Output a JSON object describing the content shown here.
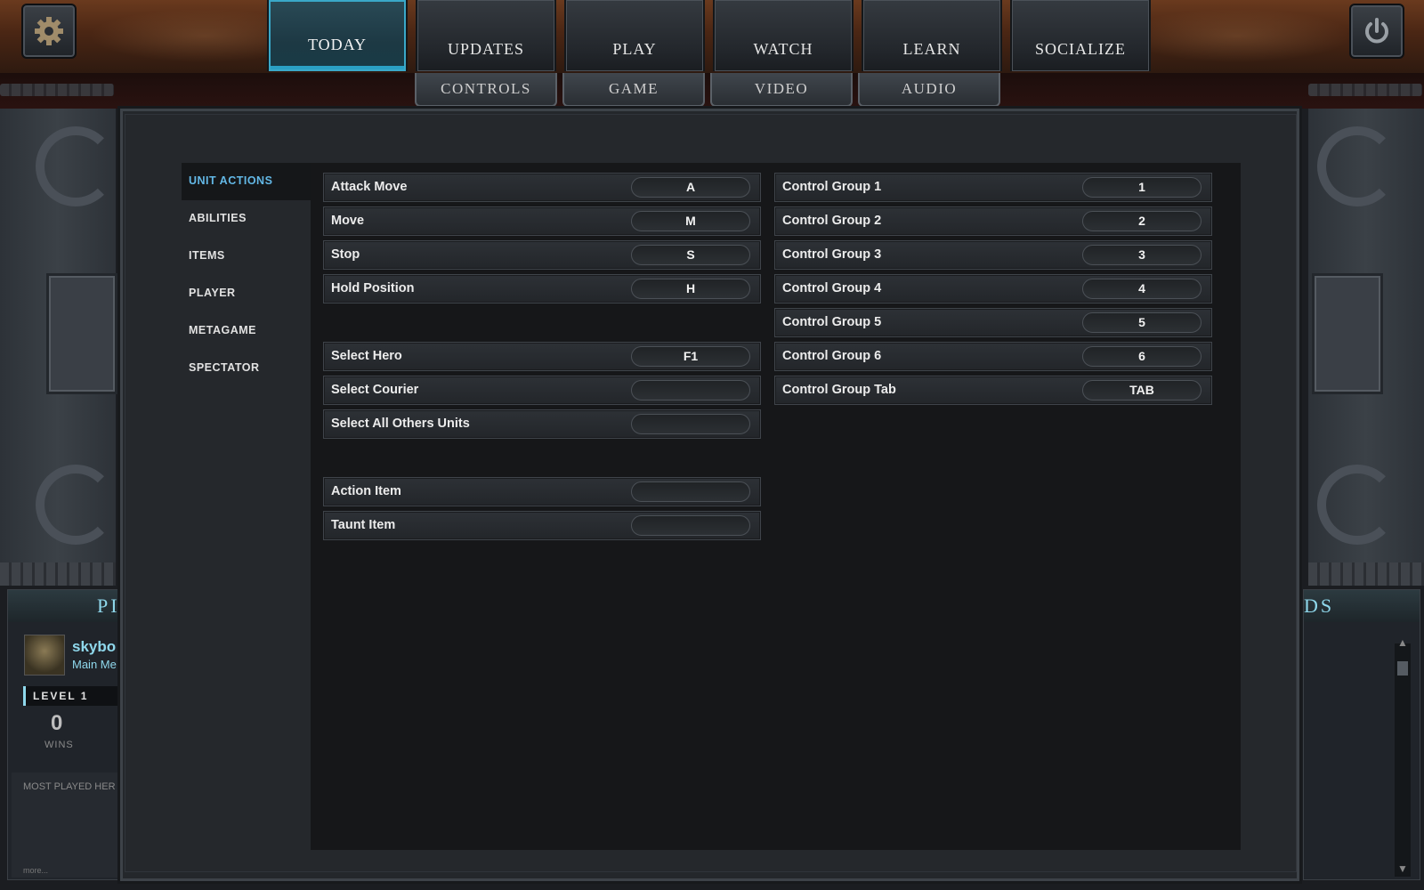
{
  "header": {
    "tabs": [
      {
        "label": "TODAY",
        "active": true
      },
      {
        "label": "UPDATES"
      },
      {
        "label": "PLAY"
      },
      {
        "label": "WATCH"
      },
      {
        "label": "LEARN"
      },
      {
        "label": "SOCIALIZE"
      }
    ],
    "settings_icon": "gear-icon",
    "power_icon": "power-icon"
  },
  "subtabs": [
    {
      "label": "CONTROLS"
    },
    {
      "label": "GAME"
    },
    {
      "label": "VIDEO"
    },
    {
      "label": "AUDIO"
    }
  ],
  "sidebar": {
    "items": [
      {
        "label": "UNIT ACTIONS",
        "active": true
      },
      {
        "label": "ABILITIES"
      },
      {
        "label": "ITEMS"
      },
      {
        "label": "PLAYER"
      },
      {
        "label": "METAGAME"
      },
      {
        "label": "SPECTATOR"
      }
    ]
  },
  "bindings_left": [
    {
      "label": "Attack Move",
      "key": "A"
    },
    {
      "label": "Move",
      "key": "M"
    },
    {
      "label": "Stop",
      "key": "S"
    },
    {
      "label": "Hold Position",
      "key": "H"
    },
    {
      "label": "Select Hero",
      "key": "F1"
    },
    {
      "label": "Select Courier",
      "key": ""
    },
    {
      "label": "Select All Others Units",
      "key": ""
    },
    {
      "label": "Action Item",
      "key": ""
    },
    {
      "label": "Taunt Item",
      "key": ""
    }
  ],
  "bindings_right": [
    {
      "label": "Control Group 1",
      "key": "1"
    },
    {
      "label": "Control Group 2",
      "key": "2"
    },
    {
      "label": "Control Group 3",
      "key": "3"
    },
    {
      "label": "Control Group 4",
      "key": "4"
    },
    {
      "label": "Control Group 5",
      "key": "5"
    },
    {
      "label": "Control Group 6",
      "key": "6"
    },
    {
      "label": "Control Group Tab",
      "key": "TAB"
    }
  ],
  "profile": {
    "banner": "PI",
    "username": "skybo",
    "location": "Main Me",
    "level": "LEVEL  1",
    "wins_count": "0",
    "wins_label": "WINS",
    "most_played": "MOST PLAYED HER",
    "more": "more..."
  },
  "right_panel": {
    "banner": "DS"
  },
  "colors": {
    "accent": "#63b8e6",
    "active_tab": "#2aa0c4",
    "top_bar": "#4a2614"
  }
}
